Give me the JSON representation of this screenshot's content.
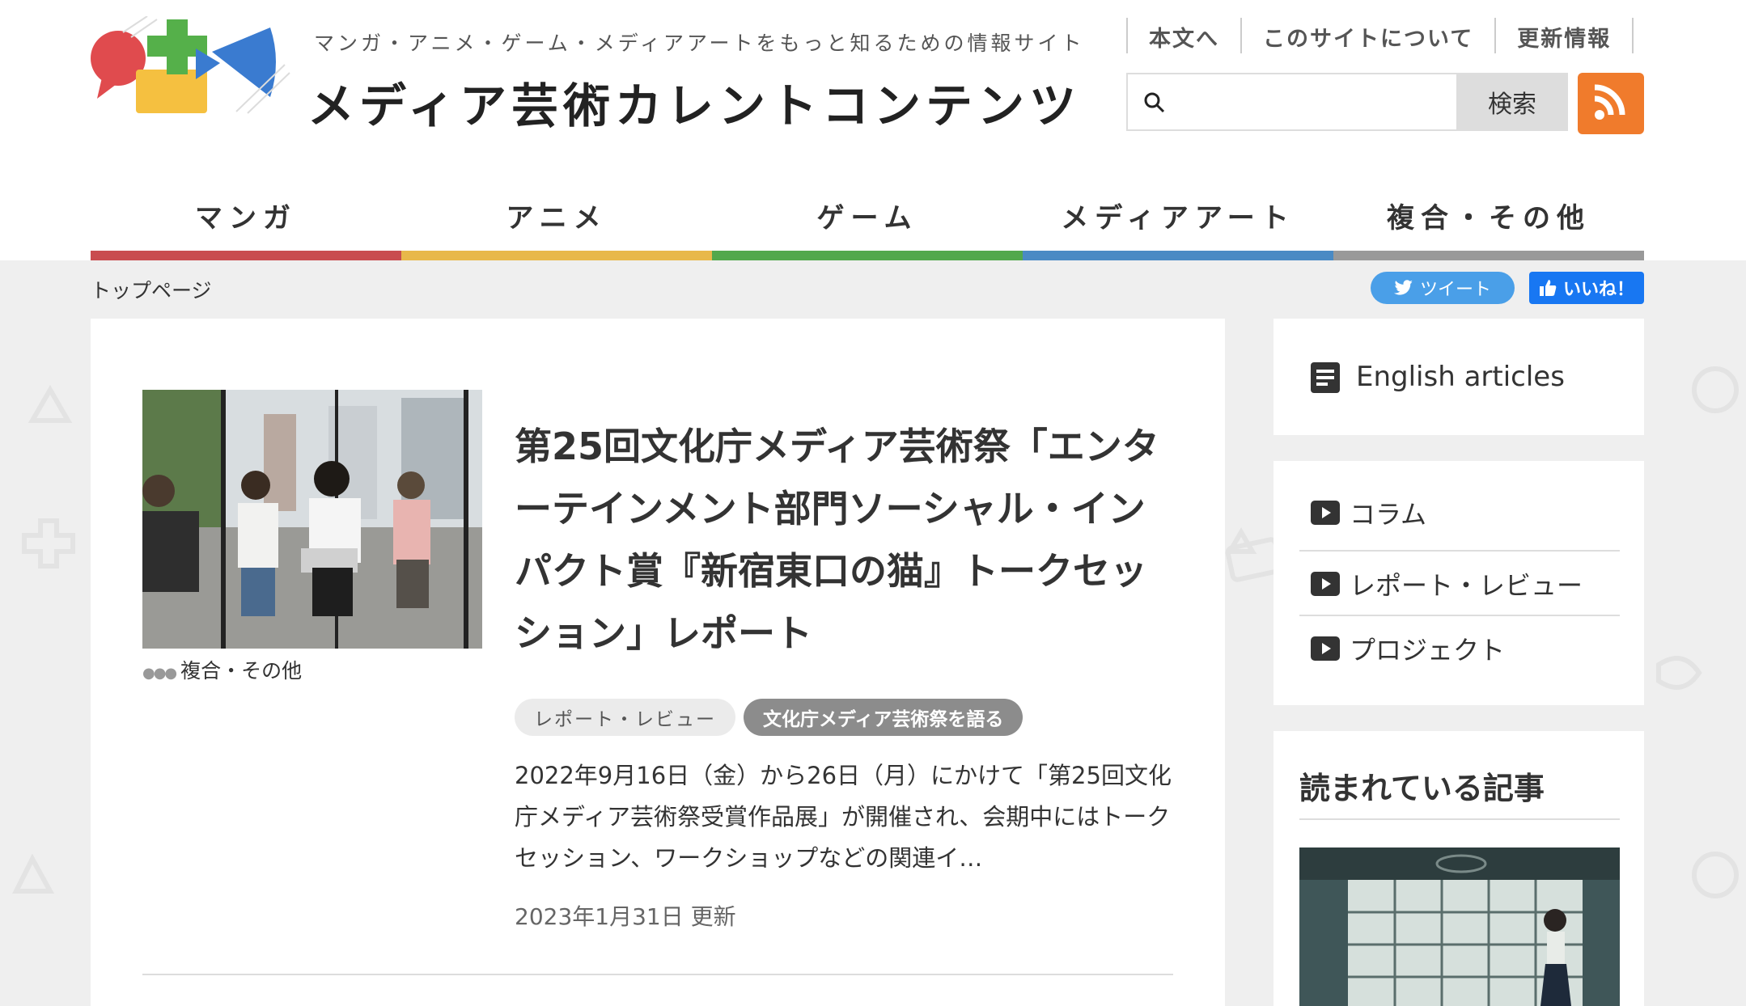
{
  "header": {
    "tagline": "マンガ・アニメ・ゲーム・メディアアートをもっと知るための情報サイト",
    "site_title": "メディア芸術カレントコンテンツ",
    "util_nav": [
      "本文へ",
      "このサイトについて",
      "更新情報"
    ],
    "search": {
      "placeholder": "",
      "button_label": "検索"
    }
  },
  "main_nav": {
    "items": [
      {
        "label": "マンガ",
        "color": "#c94c4f"
      },
      {
        "label": "アニメ",
        "color": "#e8b84a"
      },
      {
        "label": "ゲーム",
        "color": "#52a84c"
      },
      {
        "label": "メディアアート",
        "color": "#4a8ac4"
      },
      {
        "label": "複合・その他",
        "color": "#999999"
      }
    ]
  },
  "breadcrumb": "トップページ",
  "social": {
    "tweet_label": "ツイート",
    "like_label": "いいね！"
  },
  "article": {
    "category": "複合・その他",
    "title": "第25回文化庁メディア芸術祭「エンターテインメント部門ソーシャル・インパクト賞『新宿東口の猫』トークセッション」レポート",
    "tags": [
      "レポート・レビュー",
      "文化庁メディア芸術祭を語る"
    ],
    "excerpt": "2022年9月16日（金）から26日（月）にかけて「第25回文化庁メディア芸術祭受賞作品展」が開催され、会期中にはトークセッション、ワークショップなどの関連イ…",
    "date": "2023年1月31日 更新"
  },
  "sidebar": {
    "english_label": "English articles",
    "categories": [
      "コラム",
      "レポート・レビュー",
      "プロジェクト"
    ],
    "popular_title": "読まれている記事"
  },
  "colors": {
    "rss": "#f07b2c",
    "tweet": "#4a9fe8",
    "like": "#1877f2"
  }
}
